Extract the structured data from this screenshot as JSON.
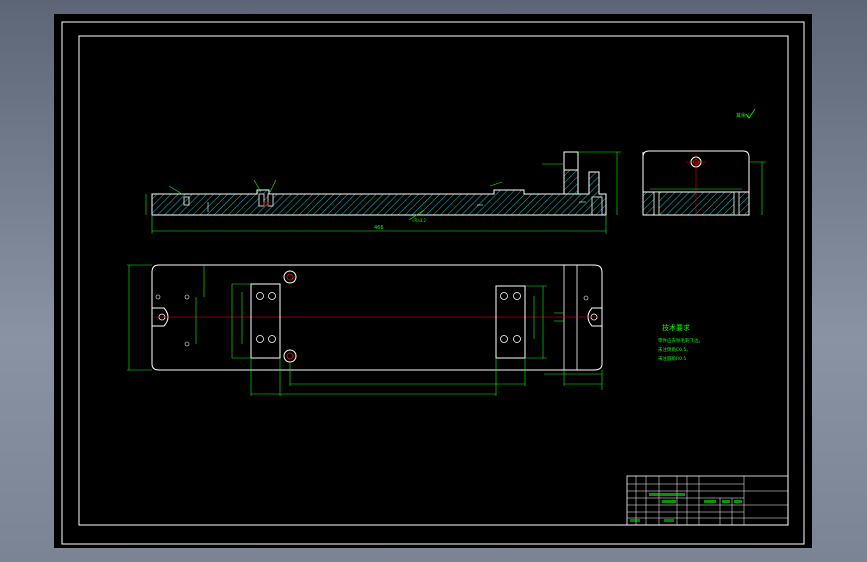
{
  "drawing": {
    "colors": {
      "background": "#000000",
      "frame": "#ffffff",
      "outline": "#ffffff",
      "dimension": "#00ff00",
      "centerline": "#ff0000",
      "hatch": "#00ffff",
      "text": "#00ff00"
    },
    "tech_requirements_title": "技术要求",
    "tech_requirements_lines": [
      "零件应去除毛刺飞边。",
      "未注倒角C0.5。",
      "未注圆角R0.5"
    ],
    "dimension_labels": {
      "front_length": "466",
      "front_center_mark": "√Ra3.2",
      "roughness_note": "其余√"
    }
  }
}
